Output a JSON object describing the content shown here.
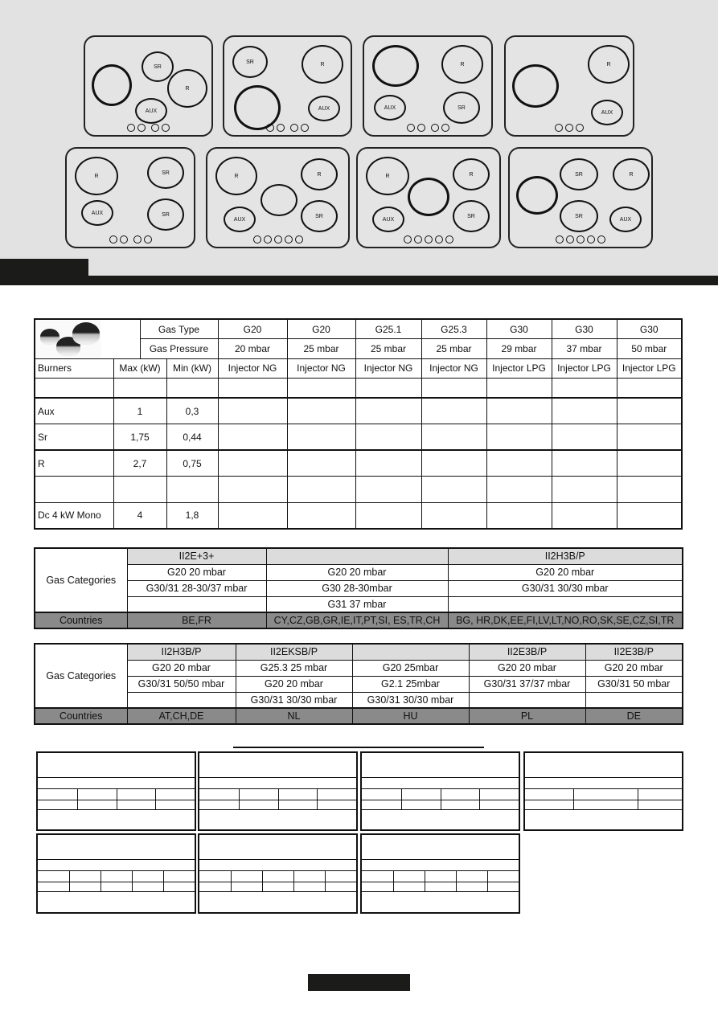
{
  "hob_layouts": [
    {
      "burners": [
        {
          "label": ""
        },
        {
          "label": "SR"
        },
        {
          "label": "R"
        },
        {
          "label": "AUX"
        }
      ],
      "knob_count": 4
    },
    {
      "burners": [
        {
          "label": "SR"
        },
        {
          "label": "R"
        },
        {
          "label": ""
        },
        {
          "label": "AUX"
        }
      ],
      "knob_count": 4
    },
    {
      "burners": [
        {
          "label": ""
        },
        {
          "label": "R"
        },
        {
          "label": "AUX"
        },
        {
          "label": "SR"
        }
      ],
      "knob_count": 4
    },
    {
      "burners": [
        {
          "label": ""
        },
        {
          "label": "R"
        },
        {
          "label": "AUX"
        }
      ],
      "knob_count": 3
    },
    {
      "burners": [
        {
          "label": "R"
        },
        {
          "label": "SR"
        },
        {
          "label": "AUX"
        },
        {
          "label": "SR"
        }
      ],
      "knob_count": 4
    },
    {
      "burners": [
        {
          "label": "R"
        },
        {
          "label": "R"
        },
        {
          "label": ""
        },
        {
          "label": "AUX"
        },
        {
          "label": "SR"
        }
      ],
      "knob_count": 5
    },
    {
      "burners": [
        {
          "label": "R"
        },
        {
          "label": "R"
        },
        {
          "label": ""
        },
        {
          "label": "AUX"
        },
        {
          "label": "SR"
        }
      ],
      "knob_count": 5
    },
    {
      "burners": [
        {
          "label": ""
        },
        {
          "label": "SR"
        },
        {
          "label": "R"
        },
        {
          "label": "SR"
        },
        {
          "label": "AUX"
        }
      ],
      "knob_count": 5
    }
  ],
  "injector_table": {
    "gas_type_label": "Gas Type",
    "gas_pressure_label": "Gas Pressure",
    "gas_types": [
      "G20",
      "G20",
      "G25.1",
      "G25.3",
      "G30",
      "G30",
      "G30"
    ],
    "pressures": [
      "20 mbar",
      "25 mbar",
      "25 mbar",
      "25 mbar",
      "29 mbar",
      "37 mbar",
      "50 mbar"
    ],
    "header": {
      "burners": "Burners",
      "max": "Max (kW)",
      "min": "Min (kW)"
    },
    "injectors": [
      "Injector NG",
      "Injector NG",
      "Injector NG",
      "Injector NG",
      "Injector LPG",
      "Injector LPG",
      "Injector LPG"
    ],
    "rows": [
      {
        "name": "Aux",
        "max": "1",
        "min": "0,3"
      },
      {
        "name": "Sr",
        "max": "1,75",
        "min": "0,44"
      },
      {
        "name": "R",
        "max": "2,7",
        "min": "0,75"
      },
      {
        "name": "",
        "max": "",
        "min": ""
      },
      {
        "name": "Dc 4 kW Mono",
        "max": "4",
        "min": "1,8"
      }
    ]
  },
  "categories_1": {
    "label": "Gas Categories",
    "countries_label": "Countries",
    "columns": [
      {
        "category": "II2E+3+",
        "gases": [
          "G20 20 mbar",
          "G30/31 28-30/37 mbar",
          ""
        ],
        "countries": "BE,FR"
      },
      {
        "category": "",
        "gases": [
          "G20 20 mbar",
          "G30 28-30mbar",
          "G31 37 mbar"
        ],
        "countries": "CY,CZ,GB,GR,IE,IT,PT,SI, ES,TR,CH"
      },
      {
        "category": "II2H3B/P",
        "gases": [
          "G20 20 mbar",
          "G30/31 30/30 mbar",
          ""
        ],
        "countries": "BG, HR,DK,EE,FI,LV,LT,NO,RO,SK,SE,CZ,SI,TR"
      }
    ]
  },
  "categories_2": {
    "label": "Gas Categories",
    "countries_label": "Countries",
    "columns": [
      {
        "category": "II2H3B/P",
        "gases": [
          "G20 20 mbar",
          "G30/31 50/50 mbar",
          ""
        ],
        "countries": "AT,CH,DE"
      },
      {
        "category": "II2EKSB/P",
        "gases": [
          "G25.3 25 mbar",
          "G20 20 mbar",
          "G30/31 30/30 mbar"
        ],
        "countries": "NL"
      },
      {
        "category": "",
        "gases": [
          "G20 25mbar",
          "G2.1 25mbar",
          "G30/31 30/30 mbar"
        ],
        "countries": "HU"
      },
      {
        "category": "II2E3B/P",
        "gases": [
          "G20 20 mbar",
          "G30/31 37/37 mbar",
          ""
        ],
        "countries": "PL"
      },
      {
        "category": "II2E3B/P",
        "gases": [
          "G20 20 mbar",
          "G30/31 50 mbar",
          ""
        ],
        "countries": "DE"
      }
    ]
  }
}
